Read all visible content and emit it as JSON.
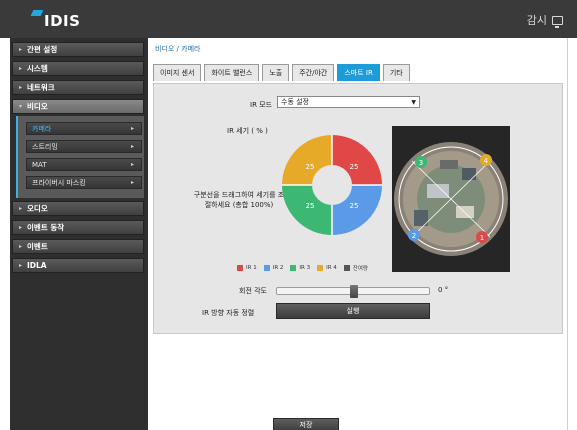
{
  "header": {
    "logo_text": "IDIS",
    "monitor_label": "감시",
    "accent_color": "#20a8e0"
  },
  "sidebar": {
    "items": [
      {
        "label": "간편 설정"
      },
      {
        "label": "시스템"
      },
      {
        "label": "네트워크"
      },
      {
        "label": "비디오",
        "expanded": true
      },
      {
        "label": "오디오"
      },
      {
        "label": "이벤트 동작"
      },
      {
        "label": "이벤트"
      },
      {
        "label": "IDLA"
      }
    ],
    "video_subitems": [
      {
        "label": "카메라",
        "selected": true
      },
      {
        "label": "스트리밍"
      },
      {
        "label": "MAT"
      },
      {
        "label": "프라이버시 마스킹"
      }
    ]
  },
  "main": {
    "breadcrumb": "비디오 / 카메라",
    "tabs": [
      {
        "label": "이미지 센서"
      },
      {
        "label": "화이트 밸런스"
      },
      {
        "label": "노출"
      },
      {
        "label": "주간/야간"
      },
      {
        "label": "스마트 IR",
        "active": true
      },
      {
        "label": "기타"
      }
    ],
    "smart_ir": {
      "ir_mode_label": "IR 모드",
      "ir_mode_value": "수동 설정",
      "intensity_label": "IR 세기 ( % )",
      "drag_help": "구분선을 드래그하여 세기를 조절하세요 (총합 100%)",
      "sectors": [
        {
          "name": "IR 1",
          "value": "25",
          "color": "#e04848"
        },
        {
          "name": "IR 2",
          "value": "25",
          "color": "#5a9ae6"
        },
        {
          "name": "IR 3",
          "value": "25",
          "color": "#3cb873"
        },
        {
          "name": "IR 4",
          "value": "25",
          "color": "#e6a928"
        }
      ],
      "legend_remaining": {
        "name": "잔여량",
        "color": "#555555"
      },
      "rotation_label": "회전 각도",
      "rotation_value": "0 °",
      "rotation_fraction": 0.5,
      "auto_align_label": "IR 방향 자동 정렬",
      "run_button": "실행"
    },
    "save_button": "저장"
  }
}
